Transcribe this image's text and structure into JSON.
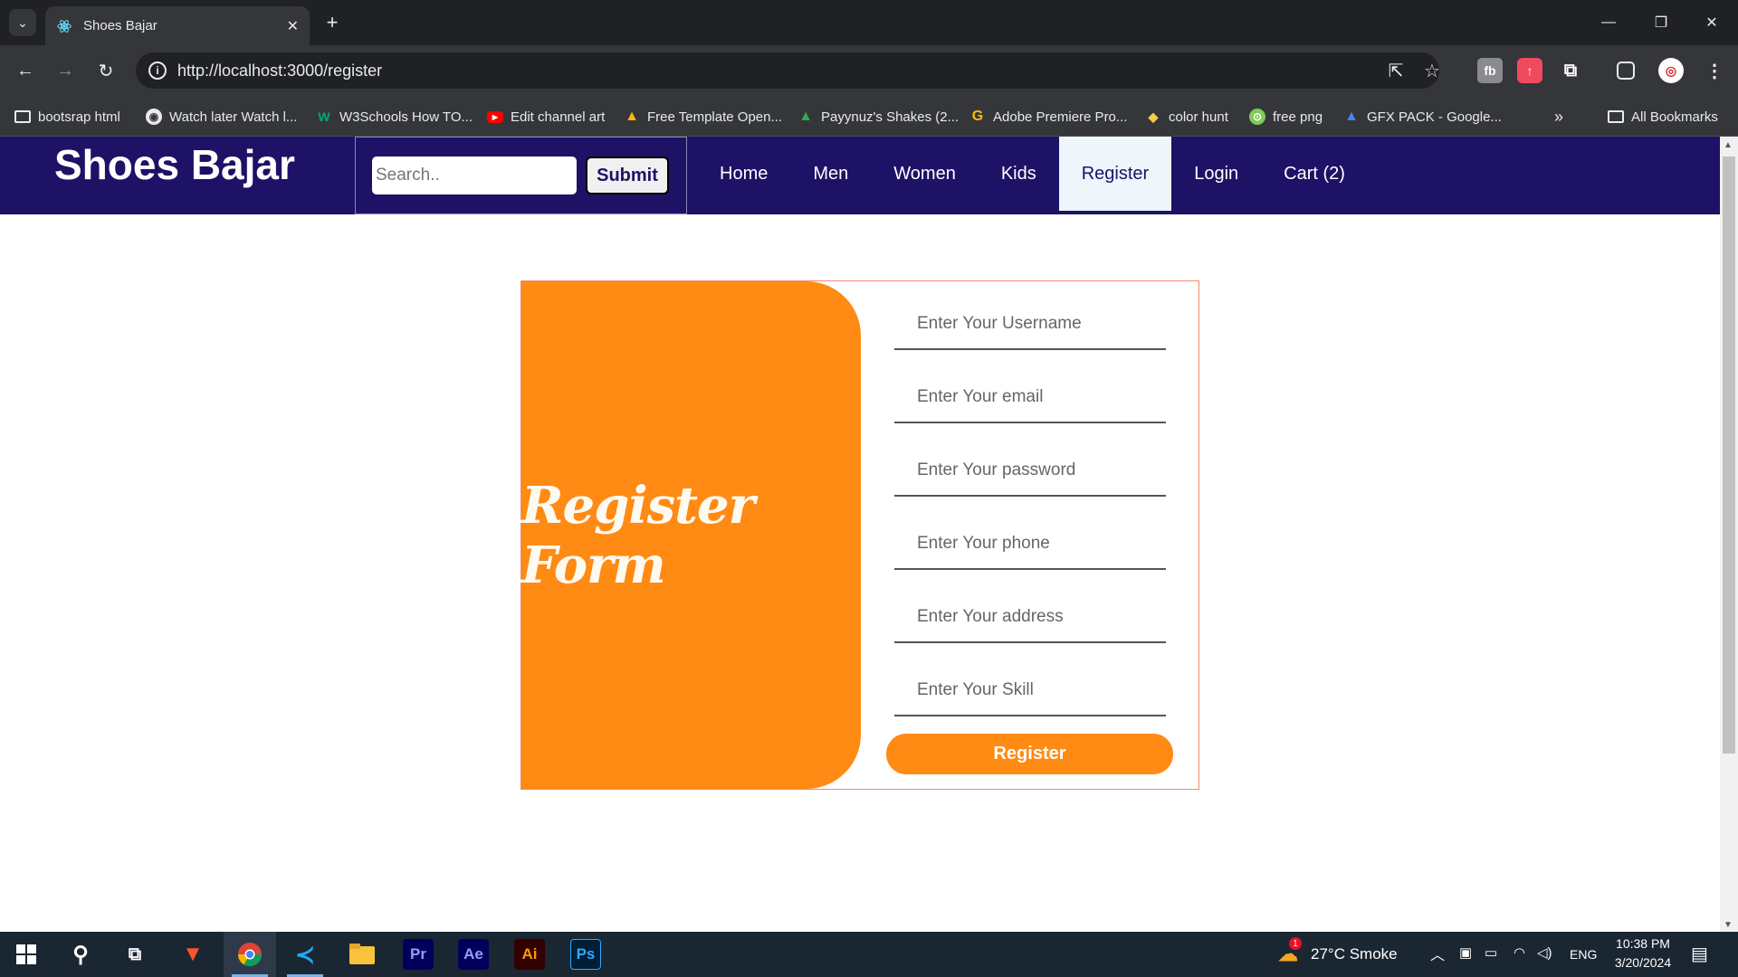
{
  "browser": {
    "tab_title": "Shoes Bajar",
    "url": "http://localhost:3000/register",
    "bookmarks": [
      {
        "label": "bootsrap html",
        "icon": "folder-icon"
      },
      {
        "label": "Watch later Watch l...",
        "icon": "globe-icon"
      },
      {
        "label": "W3Schools How TO...",
        "icon": "w3schools-icon"
      },
      {
        "label": "Edit channel art",
        "icon": "youtube-icon"
      },
      {
        "label": "Free Template Open...",
        "icon": "google-drive-icon"
      },
      {
        "label": "Payynuz's Shakes (2...",
        "icon": "google-drive-icon"
      },
      {
        "label": "Adobe Premiere Pro...",
        "icon": "google-icon"
      },
      {
        "label": "color hunt",
        "icon": "colorhunt-icon"
      },
      {
        "label": "free png",
        "icon": "pngwing-icon"
      },
      {
        "label": "GFX PACK - Google...",
        "icon": "google-drive-icon"
      }
    ],
    "all_bookmarks": "All Bookmarks"
  },
  "site": {
    "brand": "Shoes Bajar",
    "search_placeholder": "Search..",
    "search_button": "Submit",
    "menu": [
      {
        "label": "Home",
        "active": false
      },
      {
        "label": "Men",
        "active": false
      },
      {
        "label": "Women",
        "active": false
      },
      {
        "label": "Kids",
        "active": false
      },
      {
        "label": "Register",
        "active": true
      },
      {
        "label": "Login",
        "active": false
      },
      {
        "label": "Cart (2)",
        "active": false
      }
    ]
  },
  "form": {
    "title": "Register Form",
    "fields": [
      {
        "placeholder": "Enter Your Username"
      },
      {
        "placeholder": "Enter Your email"
      },
      {
        "placeholder": "Enter Your password"
      },
      {
        "placeholder": "Enter Your phone"
      },
      {
        "placeholder": "Enter Your address"
      },
      {
        "placeholder": "Enter Your Skill"
      }
    ],
    "submit": "Register"
  },
  "taskbar": {
    "weather": "27°C  Smoke",
    "weather_badge": "1",
    "language": "ENG",
    "time": "10:38 PM",
    "date": "3/20/2024",
    "apps": [
      {
        "label": "Pr",
        "icon": "premiere-icon"
      },
      {
        "label": "Ae",
        "icon": "after-effects-icon"
      },
      {
        "label": "Ai",
        "icon": "illustrator-icon"
      },
      {
        "label": "Ps",
        "icon": "photoshop-icon"
      }
    ]
  },
  "colors": {
    "navbar": "#1d1266",
    "accent_orange": "#ff8a14",
    "active_menu_bg": "#eef5fb"
  }
}
